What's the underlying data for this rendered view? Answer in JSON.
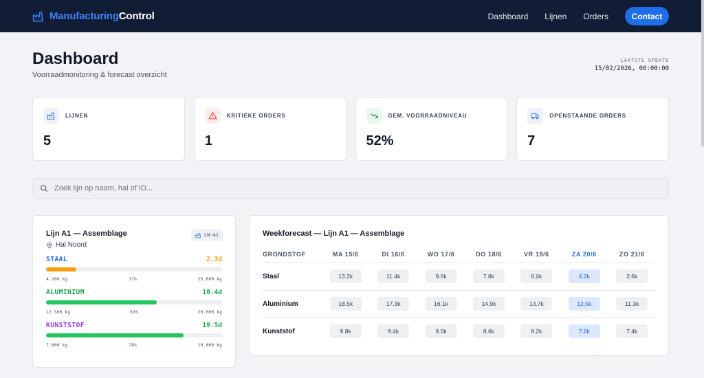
{
  "brand": {
    "part1": "Manufacturing",
    "part2": "Control"
  },
  "nav": {
    "items": [
      "Dashboard",
      "Lijnen",
      "Orders"
    ],
    "cta": "Contact"
  },
  "page": {
    "title": "Dashboard",
    "subtitle": "Voorraadmonitoring & forecast overzicht",
    "update_label": "LAATSTE UPDATE",
    "update_value": "15/02/2026, 08:00:00"
  },
  "stats": [
    {
      "label": "LIJNEN",
      "value": "5",
      "icon": "factory-icon"
    },
    {
      "label": "KRITIEKE ORDERS",
      "value": "1",
      "icon": "alert-triangle-icon"
    },
    {
      "label": "GEM. VOORRAADNIVEAU",
      "value": "52%",
      "icon": "trending-down-icon"
    },
    {
      "label": "OPENSTAANDE ORDERS",
      "value": "7",
      "icon": "truck-icon"
    }
  ],
  "search": {
    "placeholder": "Zoek lijn op naam, hal of ID..."
  },
  "line": {
    "title": "Lijn A1 — Assemblage",
    "badge": "LN-A1",
    "location": "Hal Noord",
    "materials": [
      {
        "name": "STAAL",
        "days": "2.3d",
        "current": "4.200 kg",
        "percent": "17%",
        "max": "25.000 kg",
        "fill": 0.17,
        "color": "#f59e0b",
        "name_color": "#2563eb"
      },
      {
        "name": "ALUMINIUM",
        "days": "10.4d",
        "current": "12.500 kg",
        "percent": "63%",
        "max": "20.000 kg",
        "fill": 0.63,
        "color": "#22c55e",
        "name_color": "#16a34a"
      },
      {
        "name": "KUNSTSTOF",
        "days": "19.5d",
        "current": "7.800 kg",
        "percent": "78%",
        "max": "10.000 kg",
        "fill": 0.78,
        "color": "#22c55e",
        "name_color": "#9333ea"
      }
    ]
  },
  "forecast": {
    "title": "Weekforecast — Lijn A1 — Assemblage",
    "first_header": "GRONDSTOF",
    "days": [
      "MA 15/6",
      "DI 16/6",
      "WO 17/6",
      "DO 18/6",
      "VR 19/6",
      "ZA 20/6",
      "ZO 21/6"
    ],
    "highlight_index": 5,
    "rows": [
      {
        "name": "Staal",
        "values": [
          "13.2k",
          "11.4k",
          "9.6k",
          "7.8k",
          "6.0k",
          "4.2k",
          "2.6k"
        ]
      },
      {
        "name": "Aluminium",
        "values": [
          "18.5k",
          "17.3k",
          "16.1k",
          "14.9k",
          "13.7k",
          "12.5k",
          "11.3k"
        ]
      },
      {
        "name": "Kunststof",
        "values": [
          "9.8k",
          "9.4k",
          "9.0k",
          "8.6k",
          "8.2k",
          "7.8k",
          "7.4k"
        ]
      }
    ]
  }
}
